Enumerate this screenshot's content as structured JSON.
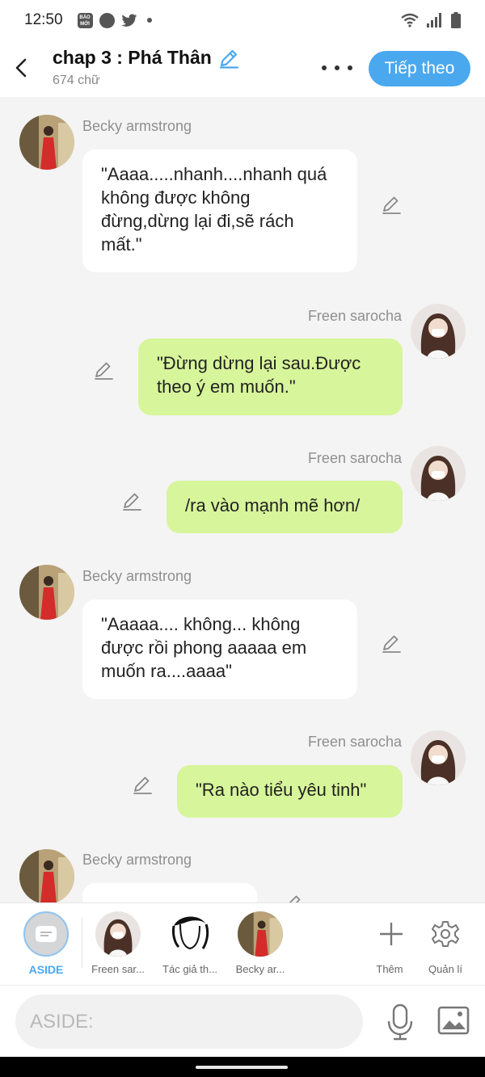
{
  "status_bar": {
    "time": "12:50",
    "left_icons": [
      "bao-moi-icon",
      "compass-icon",
      "twitter-icon",
      "dot-icon"
    ],
    "right_icons": [
      "wifi-icon",
      "signal-icon",
      "battery-icon"
    ],
    "bao_moi_text": "BÁO MỚI"
  },
  "header": {
    "title": "chap 3 : Phá Thân",
    "word_count": "674 chữ",
    "next_label": "Tiếp theo"
  },
  "colors": {
    "accent": "#4aa8ee",
    "right_bubble": "#d7f59a",
    "left_bubble": "#ffffff",
    "background": "#f4f4f4"
  },
  "messages": [
    {
      "side": "left",
      "sender": "Becky armstrong",
      "text": "\"Aaaa.....nhanh....nhanh quá không được không đừng,dừng lại đi,sẽ rách mất.\""
    },
    {
      "side": "right",
      "sender": "Freen sarocha",
      "text": "\"Đừng dừng lại sau.Được theo ý em muốn.\""
    },
    {
      "side": "right",
      "sender": "Freen sarocha",
      "text": "/ra vào mạnh mẽ hơn/"
    },
    {
      "side": "left",
      "sender": "Becky armstrong",
      "text": "\"Aaaaa.... không... không được rồi phong aaaaa em muốn ra....aaaa\""
    },
    {
      "side": "right",
      "sender": "Freen sarocha",
      "text": "\"Ra nào tiểu yêu tinh\""
    },
    {
      "side": "left",
      "sender": "Becky armstrong",
      "text": ""
    }
  ],
  "characters": [
    {
      "label": "ASIDE",
      "active": true
    },
    {
      "label": "Freen sar..."
    },
    {
      "label": "Tác giả th..."
    },
    {
      "label": "Becky ar..."
    }
  ],
  "actions": {
    "add_label": "Thêm",
    "manage_label": "Quản lí"
  },
  "input": {
    "placeholder": "ASIDE:",
    "value": ""
  }
}
